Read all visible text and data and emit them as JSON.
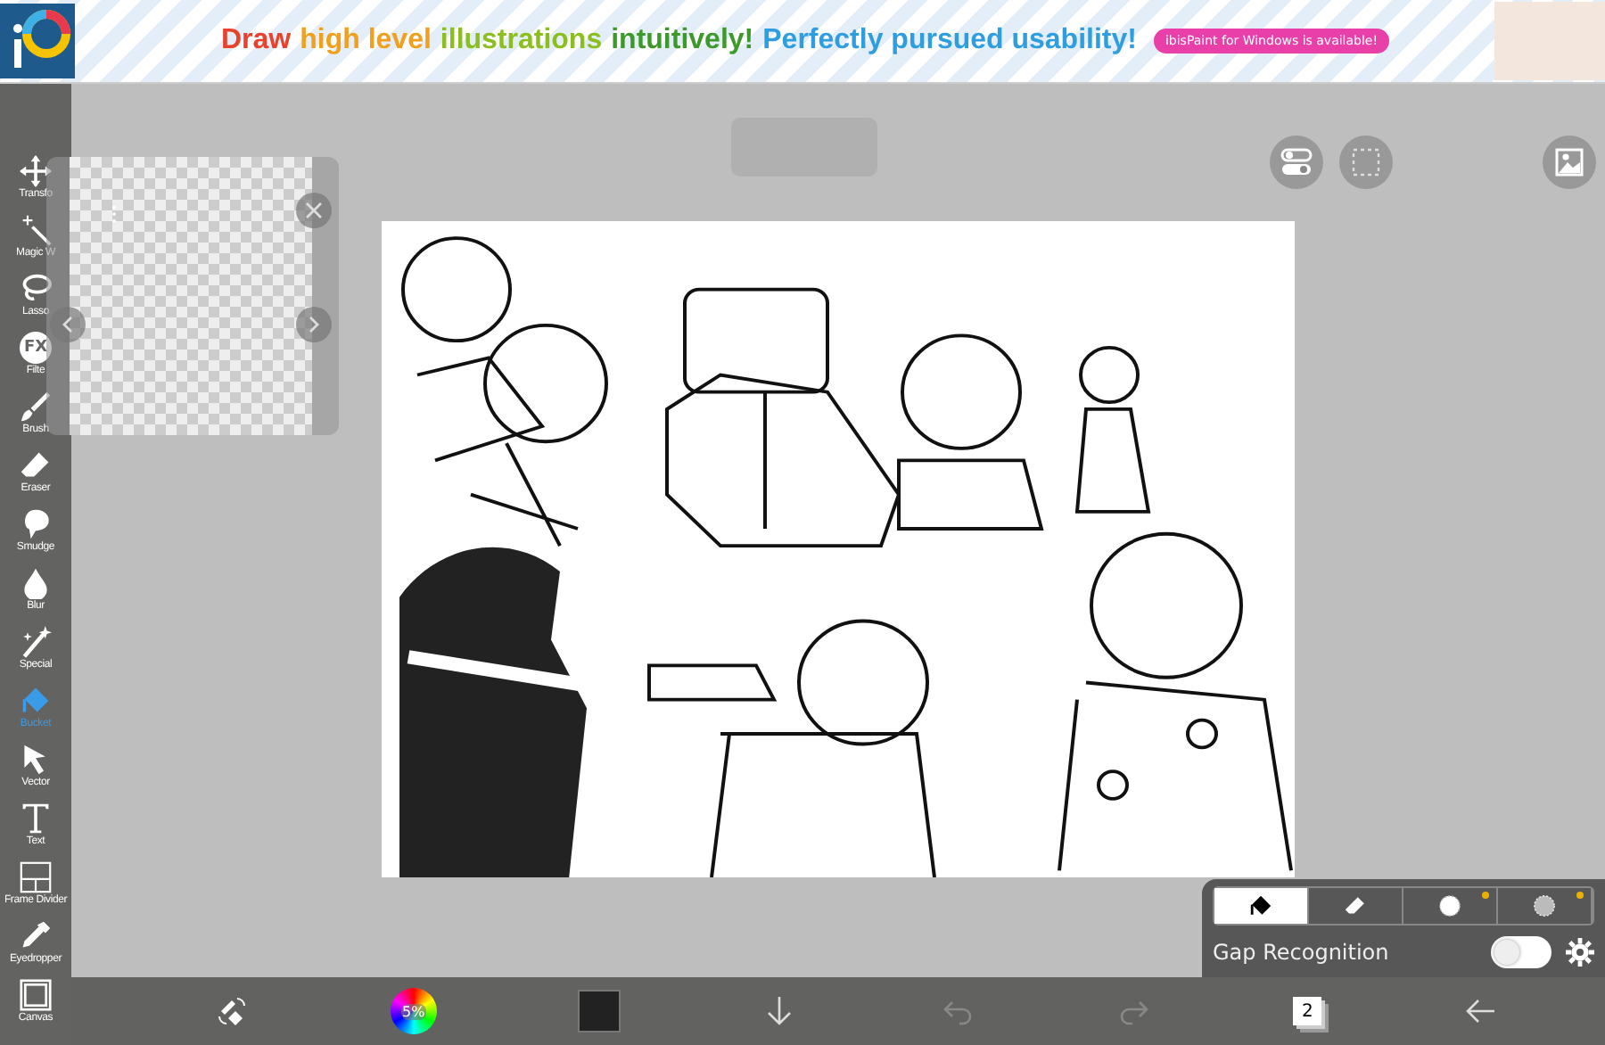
{
  "banner": {
    "headline": [
      {
        "text": "Draw",
        "color": "#e8412c"
      },
      {
        "text": "high level",
        "color": "#f0a01c"
      },
      {
        "text": "illustrations",
        "color": "#8bbf1f"
      },
      {
        "text": "intuitively!",
        "color": "#3d9a2a"
      },
      {
        "text": "Perfectly pursued usability!",
        "color": "#2e9ee0"
      }
    ],
    "badge": "ibisPaint for Windows is available!"
  },
  "tools": [
    {
      "label": "Transfo",
      "kind": "move",
      "selected": false
    },
    {
      "label": "Magic W",
      "kind": "wand",
      "selected": false
    },
    {
      "label": "Lasso",
      "kind": "lasso",
      "selected": false
    },
    {
      "label": "Filte",
      "kind": "glyph",
      "glyph": "FX",
      "selected": false
    },
    {
      "label": "Brush",
      "kind": "brush",
      "selected": false
    },
    {
      "label": "Eraser",
      "kind": "eraser",
      "selected": false
    },
    {
      "label": "Smudge",
      "kind": "smudge",
      "selected": false
    },
    {
      "label": "Blur",
      "kind": "drop",
      "selected": false
    },
    {
      "label": "Special",
      "kind": "sparkle",
      "selected": false
    },
    {
      "label": "Bucket",
      "kind": "bucket",
      "selected": true
    },
    {
      "label": "Vector",
      "kind": "cursor",
      "selected": false
    },
    {
      "label": "Text",
      "kind": "text",
      "selected": false
    },
    {
      "label": "Frame Divider",
      "kind": "frame",
      "selected": false
    },
    {
      "label": "Eyedropper",
      "kind": "dropper",
      "selected": false
    },
    {
      "label": "Canvas",
      "kind": "canvas",
      "selected": false
    }
  ],
  "fill_panel": {
    "modes": [
      {
        "kind": "bucket",
        "selected": true,
        "badge": false
      },
      {
        "kind": "eraser",
        "selected": false,
        "badge": false
      },
      {
        "kind": "circle",
        "selected": false,
        "badge": true
      },
      {
        "kind": "dotted",
        "selected": false,
        "badge": true
      }
    ],
    "gap_recognition": {
      "label": "Gap Recognition",
      "on": false
    }
  },
  "bottom_bar": {
    "brush_size": "5%",
    "color": "#222222",
    "undo_disabled": true,
    "redo_disabled": true,
    "layer_count": "2"
  }
}
